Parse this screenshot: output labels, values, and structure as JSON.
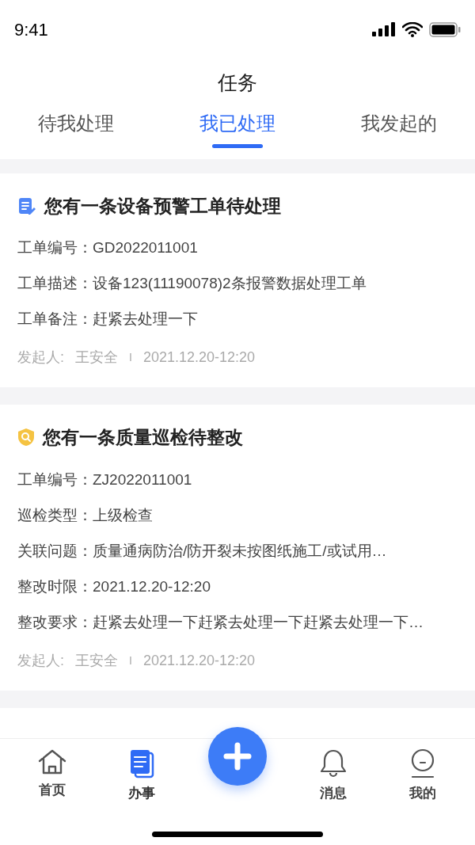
{
  "status_bar": {
    "time": "9:41"
  },
  "header": {
    "title": "任务"
  },
  "tabs": [
    {
      "label": "待我处理",
      "selected": false
    },
    {
      "label": "我已处理",
      "selected": true
    },
    {
      "label": "我发起的",
      "selected": false
    }
  ],
  "cards": [
    {
      "kind": "document",
      "title": "您有一条设备预警工单待处理",
      "fields": [
        {
          "label": "工单编号：",
          "value": "GD2022011001"
        },
        {
          "label": "工单描述：",
          "value": "设备123(11190078)2条报警数据处理工单"
        },
        {
          "label": "工单备注：",
          "value": "赶紧去处理一下"
        }
      ],
      "initiator_label": "发起人:",
      "initiator": "王安全",
      "separator": "I",
      "time": "2021.12.20-12:20"
    },
    {
      "kind": "inspection",
      "title": "您有一条质量巡检待整改",
      "fields": [
        {
          "label": "工单编号：",
          "value": "ZJ2022011001"
        },
        {
          "label": "巡检类型：",
          "value": "上级检查"
        },
        {
          "label": "关联问题：",
          "value": "质量通病防治/防开裂未按图纸施工/或试用…"
        },
        {
          "label": "整改时限：",
          "value": "2021.12.20-12:20"
        },
        {
          "label": "整改要求：",
          "value": "赶紧去处理一下赶紧去处理一下赶紧去处理一下…"
        }
      ],
      "initiator_label": "发起人:",
      "initiator": "王安全",
      "separator": "I",
      "time": "2021.12.20-12:20"
    }
  ],
  "nav": [
    {
      "kind": "home",
      "label": "首页",
      "selected": false
    },
    {
      "kind": "tasks",
      "label": "办事",
      "selected": true
    },
    {
      "kind": "bell",
      "label": "消息",
      "selected": false
    },
    {
      "kind": "profile",
      "label": "我的",
      "selected": false
    }
  ]
}
